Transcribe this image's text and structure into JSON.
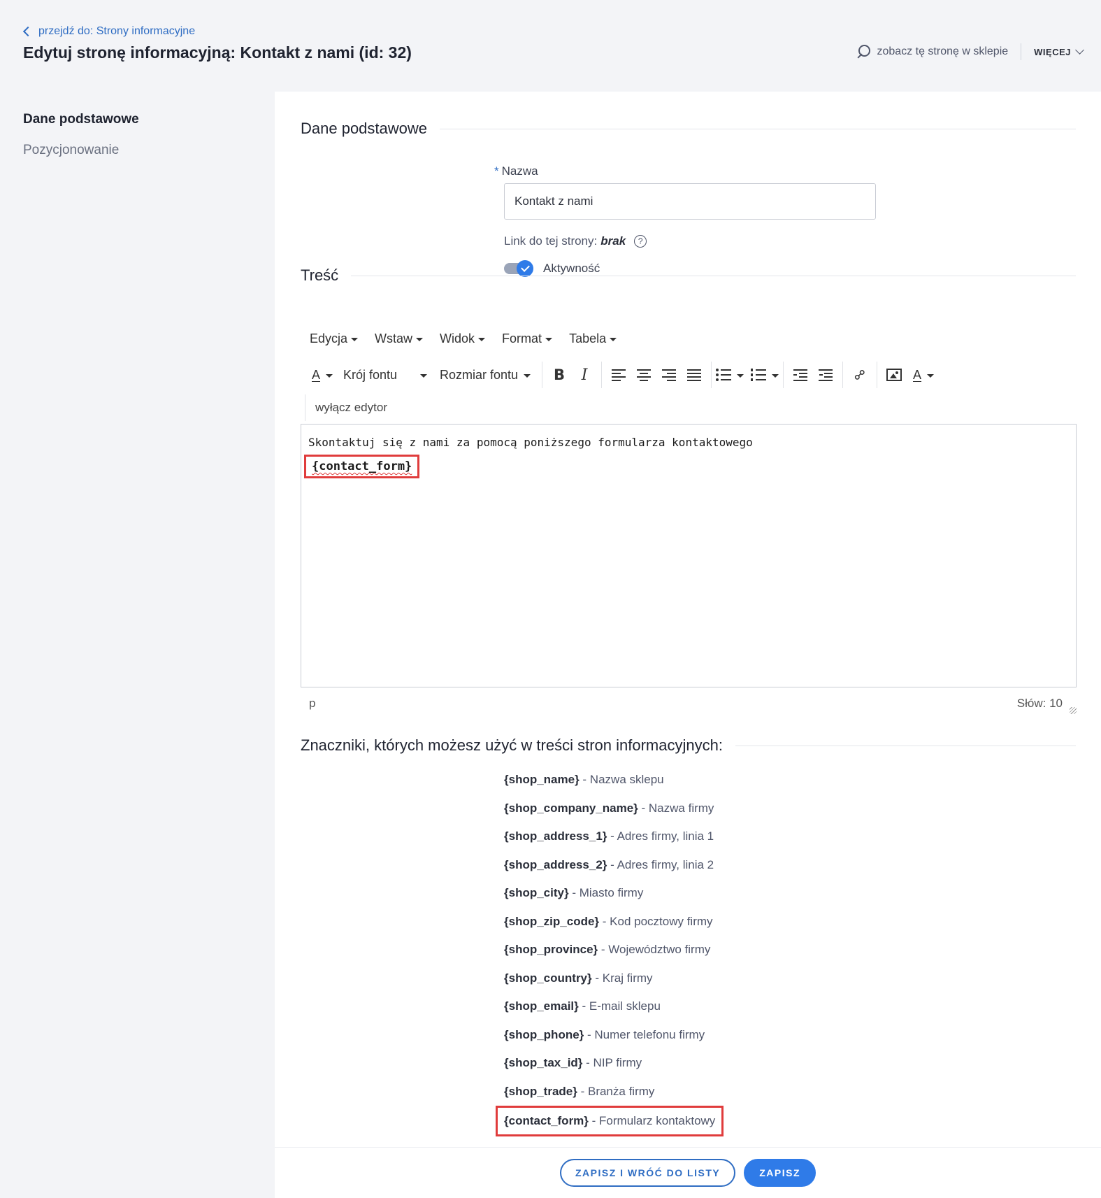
{
  "header": {
    "breadcrumb": "przejdź do: Strony informacyjne",
    "title": "Edytuj stronę informacyjną: Kontakt z nami (id: 32)",
    "view_in_shop": "zobacz tę stronę w sklepie",
    "more": "WIĘCEJ"
  },
  "sidebar": {
    "items": [
      {
        "label": "Dane podstawowe"
      },
      {
        "label": "Pozycjonowanie"
      }
    ]
  },
  "basic": {
    "section_title": "Dane podstawowe",
    "name_label": "Nazwa",
    "name_value": "Kontakt z nami",
    "link_label": "Link do tej strony:",
    "link_value": "brak",
    "active_label": "Aktywność"
  },
  "content": {
    "section_title": "Treść",
    "menus": [
      "Edycja",
      "Wstaw",
      "Widok",
      "Format",
      "Tabela"
    ],
    "font_family": "Krój fontu",
    "font_size": "Rozmiar fontu",
    "disable_editor": "wyłącz edytor",
    "editor_text": "Skontaktuj się z nami za pomocą poniższego formularza kontaktowego",
    "editor_tag": "{contact_form}",
    "status_path": "p",
    "word_count": "Słów: 10"
  },
  "tags": {
    "section_title": "Znaczniki, których możesz użyć w treści stron informacyjnych:",
    "items": [
      {
        "tag": "{shop_name}",
        "desc": " - Nazwa sklepu"
      },
      {
        "tag": "{shop_company_name}",
        "desc": " - Nazwa firmy"
      },
      {
        "tag": "{shop_address_1}",
        "desc": " - Adres firmy, linia 1"
      },
      {
        "tag": "{shop_address_2}",
        "desc": " - Adres firmy, linia 2"
      },
      {
        "tag": "{shop_city}",
        "desc": " - Miasto firmy"
      },
      {
        "tag": "{shop_zip_code}",
        "desc": " - Kod pocztowy firmy"
      },
      {
        "tag": "{shop_province}",
        "desc": " - Województwo firmy"
      },
      {
        "tag": "{shop_country}",
        "desc": " - Kraj firmy"
      },
      {
        "tag": "{shop_email}",
        "desc": " - E-mail sklepu"
      },
      {
        "tag": "{shop_phone}",
        "desc": " - Numer telefonu firmy"
      },
      {
        "tag": "{shop_tax_id}",
        "desc": " - NIP firmy"
      },
      {
        "tag": "{shop_trade}",
        "desc": " - Branża firmy"
      },
      {
        "tag": "{contact_form}",
        "desc": " - Formularz kontaktowy"
      }
    ]
  },
  "footer": {
    "save_and_back": "ZAPISZ I WRÓĆ DO LISTY",
    "save": "ZAPISZ"
  },
  "colors": {
    "accent": "#2f7be8",
    "link": "#2f6dc3",
    "highlight": "#e03c3c"
  }
}
